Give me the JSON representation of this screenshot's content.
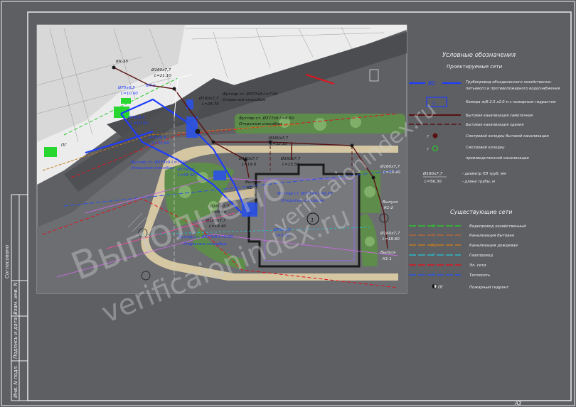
{
  "legend": {
    "title": "Условные обозначения",
    "subtitle_proj": "Проектируемые сети",
    "subtitle_exist": "Существующие сети",
    "proj_items": [
      {
        "code": "В0",
        "text": "Трубопровод объединенного хозяйственно-",
        "text2": "питьевого и противопожарного водоснабжения"
      },
      {
        "code": "",
        "text": "Камера ж/б 2.5 х2.0 м с пожарным гидрантом"
      },
      {
        "code": "",
        "text": "Бытовая канализация самотечная"
      },
      {
        "code": "",
        "text": "Бытовая канализация здания"
      },
      {
        "code": "",
        "text": "Смотровой колодец бытовой канализации"
      },
      {
        "code": "",
        "text": "Смотровой колодец",
        "text2": "производственной канализации"
      }
    ],
    "pipe_diam": "Ø160х7,7",
    "pipe_len": "L=56.30",
    "pipe_diam_text": "- диаметр ПЭ труб, мм",
    "pipe_len_text": "- длина трубы, м",
    "exist_items": [
      {
        "code": "В",
        "text": "Водопровод хозяйственный",
        "color": "#29c62c"
      },
      {
        "code": "К",
        "text": "Канализация бытовая",
        "color": "#b0663a"
      },
      {
        "code": "Кд",
        "text": "Канализация дождевая",
        "color": "#c27a22"
      },
      {
        "code": "Г",
        "text": "Газопровод",
        "color": "#28b8c8"
      },
      {
        "code": "",
        "text": "Эл. сети",
        "color": "#e0141e"
      },
      {
        "code": "Т",
        "text": "Теплосеть",
        "color": "#2a52e6"
      },
      {
        "code": "ПГ",
        "text": "Пожарный гидрант",
        "color": "#e8e8e8"
      }
    ]
  },
  "plan": {
    "labels": [
      "КК-35",
      "Ø160х7,7",
      "L=21.10",
      "ВП-1",
      "Ø75х6,5",
      "L=10.00",
      "Ø75х6,5",
      "L=10.50",
      "Ø160х7,7",
      "L=26.70",
      "Футляр ст. Ø377х9 L=7.00",
      "Открытым способом",
      "Футляр ст. Ø377х9 L=6.60",
      "Открытым способом",
      "Ø160х7,7",
      "L=32.10",
      "Ø75х6,5",
      "L=55.00",
      "Футляр ст. Ø273х9 L=7.00",
      "Открытым способом",
      "Ø75х6,5",
      "L=58.50",
      "Ø160х7,7",
      "L=19.0",
      "Ø160х7,7",
      "L=15.50",
      "Выпуск",
      "К1-3",
      "Футляр ст. Ø377х9 L=6.20",
      "Открытым способом",
      "Ø75х6,5",
      "L=5.50",
      "Футляр ст. Ø377х9 L=6.00",
      "Открытым способом",
      "Ø160х7,7",
      "L=8.60",
      "Ø160х7,7",
      "L=18.40",
      "Выпуск",
      "К1-2",
      "Ø160х7,7",
      "L=18.60",
      "Выпуск",
      "К1-1",
      "ПГ",
      "Ø160х7,7",
      "L=19.40"
    ],
    "watermark1": "Выполнено",
    "watermark2": "verificaionindex.ru",
    "site_watermark": "verificaionindex.ru"
  },
  "stamp": {
    "sheet_format": "А3",
    "side_labels": [
      "Согласовано",
      "Взам. инв. N",
      "Подпись и дата",
      "Инв. N подл."
    ]
  }
}
